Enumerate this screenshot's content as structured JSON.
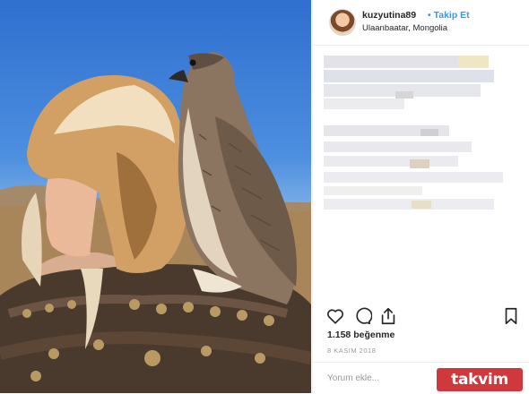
{
  "post": {
    "username": "kuzyutina89",
    "separator": "•",
    "follow_label": "Takip Et",
    "location": "Ulaanbaatar, Mongolia",
    "likes": "1.158 beğenme",
    "date": "8 KASIM 2018",
    "comment_placeholder": "Yorum ekle..."
  },
  "icons": {
    "like": "heart-icon",
    "comment": "comment-icon",
    "share": "share-icon",
    "save": "bookmark-icon"
  },
  "watermark": {
    "text": "takvim",
    "color": "#c81e23"
  },
  "colors": {
    "link": "#3897f0",
    "text": "#262626",
    "muted": "#999999"
  }
}
